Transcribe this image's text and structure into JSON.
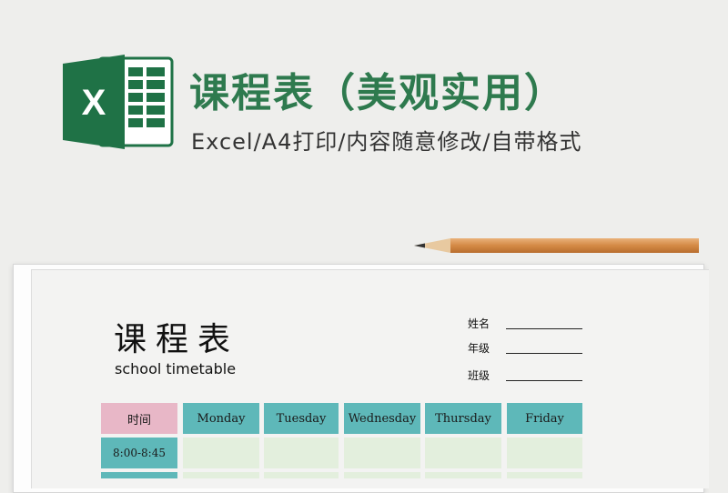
{
  "banner": {
    "title": "课程表（美观实用）",
    "subtitle": "Excel/A4打印/内容随意修改/自带格式",
    "logo_letter": "X",
    "accent_color": "#2e7a4e"
  },
  "sheet": {
    "title": "课程表",
    "subtitle": "school timetable",
    "fields": [
      {
        "label": "姓名"
      },
      {
        "label": "年级"
      },
      {
        "label": "班级"
      }
    ],
    "table": {
      "corner": "时间",
      "days": [
        "Monday",
        "Tuesday",
        "Wednesday",
        "Thursday",
        "Friday"
      ],
      "rows": [
        {
          "time": "8:00-8:45"
        }
      ],
      "colors": {
        "header": "#5eb8b9",
        "corner": "#e8b7c7",
        "cell": "#e3efdd"
      }
    }
  }
}
